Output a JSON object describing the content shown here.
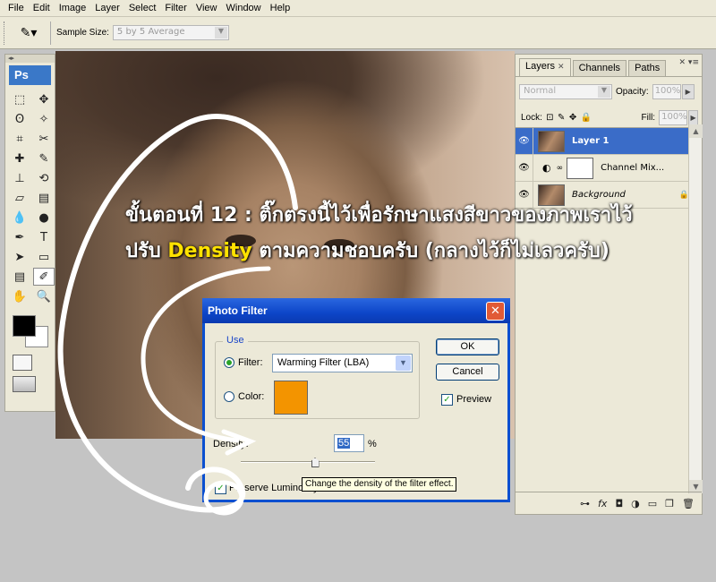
{
  "menu": [
    "File",
    "Edit",
    "Image",
    "Layer",
    "Select",
    "Filter",
    "View",
    "Window",
    "Help"
  ],
  "options_bar": {
    "sample_size_label": "Sample Size:",
    "sample_size_value": "5 by 5 Average"
  },
  "toolbox": {
    "logo": "Ps",
    "foreground": "#000000",
    "background": "#ffffff"
  },
  "layers_panel": {
    "tabs": [
      "Layers",
      "Channels",
      "Paths"
    ],
    "blend_mode": "Normal",
    "opacity_label": "Opacity:",
    "opacity_value": "100%",
    "lock_label": "Lock:",
    "fill_label": "Fill:",
    "fill_value": "100%",
    "layers": [
      {
        "name": "Layer 1",
        "selected": true
      },
      {
        "name": "Channel Mix...",
        "selected": false
      },
      {
        "name": "Background",
        "selected": false
      }
    ]
  },
  "dialog": {
    "title": "Photo Filter",
    "use_label": "Use",
    "filter_label": "Filter:",
    "filter_value": "Warming Filter (LBA)",
    "color_label": "Color:",
    "color_value": "#f39400",
    "ok_label": "OK",
    "cancel_label": "Cancel",
    "preview_label": "Preview",
    "preview_checked": true,
    "density_label": "Density:",
    "density_value": "55",
    "density_unit": "%",
    "density_fraction": 0.55,
    "preserve_label": "Preserve Luminosity",
    "preserve_checked": true,
    "tooltip": "Change the density of the filter effect."
  },
  "caption": {
    "line1": "ขั้นตอนที่ 12 : ติ๊กตรงนี้ไว้เพื่อรักษาแสงสีขาวของภาพเราไว้",
    "line2_prefix": "ปรับ ",
    "line2_highlight": "Density",
    "line2_suffix": " ตามความชอบครับ (กลางไว้ก็ไม่เลวครับ)"
  }
}
